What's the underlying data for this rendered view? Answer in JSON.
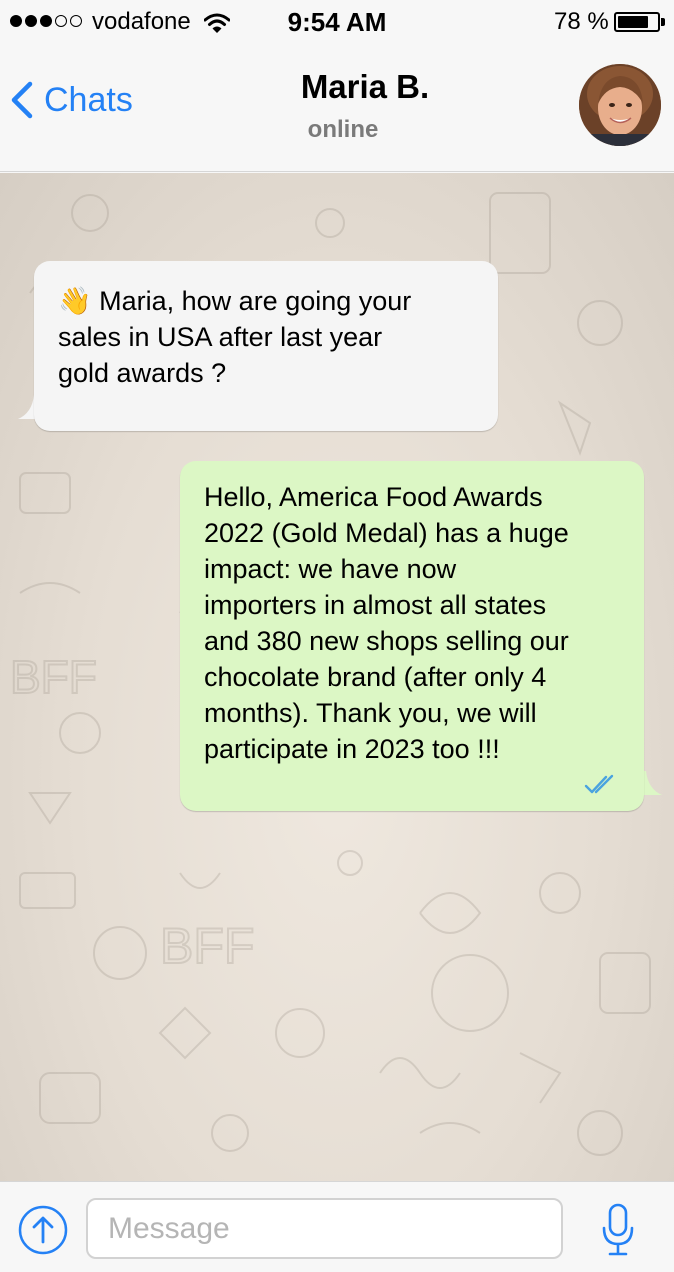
{
  "status_bar": {
    "carrier": "vodafone",
    "time": "9:54 AM",
    "battery_percent": "78 %",
    "battery_level": 0.78,
    "signal_bars_filled": 3,
    "signal_bars_total": 5,
    "icons": [
      "signal-dots-icon",
      "wifi-icon",
      "battery-icon"
    ]
  },
  "nav": {
    "back_label": "Chats",
    "contact_name": "Maria B.",
    "contact_status": "online",
    "icons": [
      "chevron-left-icon",
      "avatar"
    ]
  },
  "messages": [
    {
      "direction": "incoming",
      "emoji": "👋",
      "text": " Maria, how are going your\nsales in USA after last year\ngold awards ?"
    },
    {
      "direction": "outgoing",
      "text": "Hello, America Food Awards\n2022 (Gold Medal) has a huge\nimpact: we have now\nimporters in almost all states\nand 380 new shops selling our\nchocolate brand (after only 4\nmonths). Thank you, we will\nparticipate in 2023 too !!!",
      "status": "read"
    }
  ],
  "input_bar": {
    "placeholder": "Message",
    "value": "",
    "icons": [
      "upload-circle-icon",
      "microphone-icon"
    ]
  },
  "colors": {
    "accent": "#2481f5",
    "outgoing_bubble": "#dcf7c5",
    "incoming_bubble": "#f5f5f5",
    "chat_background": "#e5ddd3",
    "read_ticks": "#4aa3df"
  }
}
